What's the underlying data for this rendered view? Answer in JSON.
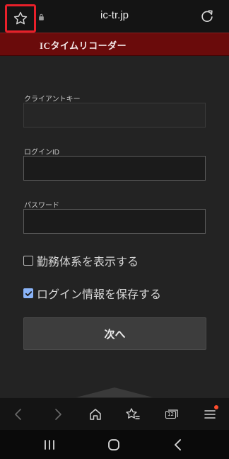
{
  "browser": {
    "url": "ic-tr.jp"
  },
  "site": {
    "title": "ICタイムリコーダー"
  },
  "form": {
    "client_key_label": "クライアントキー",
    "client_key_value": "",
    "login_id_label": "ログインID",
    "login_id_value": "",
    "password_label": "パスワード",
    "password_value": "",
    "show_work_system_label": "勤務体系を表示する",
    "show_work_system_checked": false,
    "save_login_label": "ログイン情報を保存する",
    "save_login_checked": true,
    "next_button_label": "次へ"
  },
  "toolbar": {
    "tab_count": "12"
  },
  "colors": {
    "header_bg": "#6a0b0b",
    "highlight": "#e8202a",
    "checkbox_accent": "#8ab4f8",
    "notification_dot": "#ff4d2e"
  },
  "icons": {
    "bookmark": "star-icon",
    "secure": "lock-icon",
    "reload": "reload-icon",
    "back": "chevron-left-icon",
    "forward": "chevron-right-icon",
    "home": "home-icon",
    "bookmarks": "star-list-icon",
    "tabs": "tabs-icon",
    "menu": "menu-icon"
  }
}
